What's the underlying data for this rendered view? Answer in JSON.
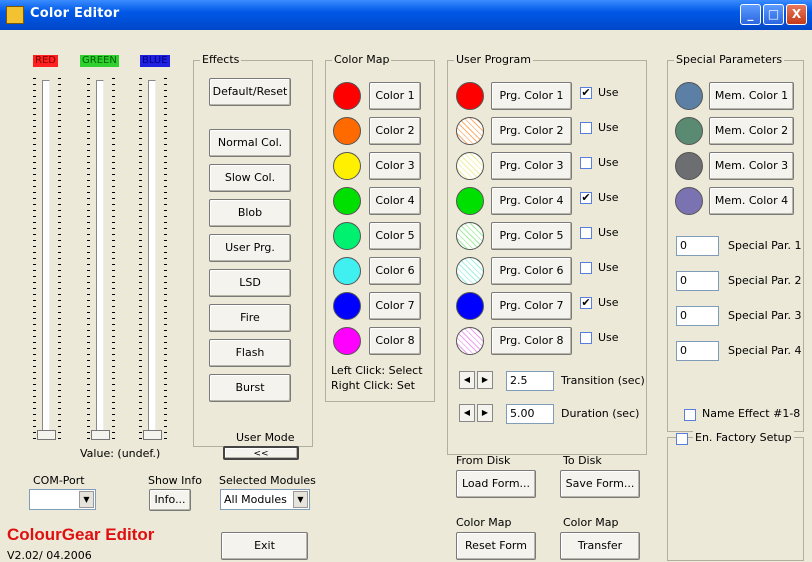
{
  "window": {
    "title": "Color Editor",
    "minimize": "_",
    "maximize": "□",
    "close": "X"
  },
  "sliders": {
    "red_label": "RED",
    "green_label": "GREEN",
    "blue_label": "BLUE",
    "colors": {
      "red": "#FF2020",
      "green": "#30D030",
      "blue": "#2020E0"
    },
    "value_label": "Value: (undef.)"
  },
  "effects": {
    "caption": "Effects",
    "buttons": [
      "Default/Reset",
      "Normal Col.",
      "Slow Col.",
      "Blob",
      "User Prg.",
      "LSD",
      "Fire",
      "Flash",
      "Burst"
    ]
  },
  "color_map": {
    "caption": "Color Map",
    "items": [
      {
        "label": "Color 1",
        "color": "#FF0000"
      },
      {
        "label": "Color 2",
        "color": "#FF6A00"
      },
      {
        "label": "Color 3",
        "color": "#FFF000"
      },
      {
        "label": "Color 4",
        "color": "#00E000"
      },
      {
        "label": "Color 5",
        "color": "#00F070"
      },
      {
        "label": "Color 6",
        "color": "#40F0F0"
      },
      {
        "label": "Color 7",
        "color": "#0000FF"
      },
      {
        "label": "Color 8",
        "color": "#FF00FF"
      }
    ],
    "hint_left": "Left Click: Select",
    "hint_right": "Right Click: Set"
  },
  "user_program": {
    "caption": "User Program",
    "use_label": "Use",
    "items": [
      {
        "label": "Prg. Color 1",
        "color": "#FF0000",
        "hatched": false,
        "use": true
      },
      {
        "label": "Prg. Color 2",
        "color": "#FFB070",
        "hatched": true,
        "use": false
      },
      {
        "label": "Prg. Color 3",
        "color": "#F0F0A0",
        "hatched": true,
        "use": false
      },
      {
        "label": "Prg. Color 4",
        "color": "#00E000",
        "hatched": false,
        "use": true
      },
      {
        "label": "Prg. Color 5",
        "color": "#A0F0A0",
        "hatched": true,
        "use": false
      },
      {
        "label": "Prg. Color 6",
        "color": "#A0F0E0",
        "hatched": true,
        "use": false
      },
      {
        "label": "Prg. Color 7",
        "color": "#0000FF",
        "hatched": false,
        "use": true
      },
      {
        "label": "Prg. Color 8",
        "color": "#F0A0F0",
        "hatched": true,
        "use": false
      }
    ],
    "transition_value": "2.5",
    "transition_label": "Transition (sec)",
    "duration_value": "5.00",
    "duration_label": "Duration (sec)"
  },
  "special": {
    "caption": "Special Parameters",
    "mem_colors": [
      {
        "label": "Mem. Color 1",
        "color": "#5C7FA6"
      },
      {
        "label": "Mem. Color 2",
        "color": "#5B8A72"
      },
      {
        "label": "Mem. Color 3",
        "color": "#6D6E72"
      },
      {
        "label": "Mem. Color 4",
        "color": "#7B72B2"
      }
    ],
    "params": [
      {
        "value": "0",
        "label": "Special Par. 1"
      },
      {
        "value": "0",
        "label": "Special Par. 2"
      },
      {
        "value": "0",
        "label": "Special Par. 3"
      },
      {
        "value": "0",
        "label": "Special Par. 4"
      }
    ],
    "name_effect_label": "Name Effect #1-8",
    "factory_label": "En. Factory Setup"
  },
  "bottom": {
    "com_port_label": "COM-Port",
    "show_info_label": "Show Info",
    "info_button": "Info...",
    "user_mode_label": "User Mode",
    "user_mode_button": "<<",
    "selected_modules_label": "Selected Modules",
    "selected_modules_value": "All Modules",
    "exit_button": "Exit",
    "from_disk_label": "From Disk",
    "to_disk_label": "To Disk",
    "load_button": "Load Form...",
    "save_button": "Save Form...",
    "color_map_label1": "Color Map",
    "color_map_label2": "Color Map",
    "reset_button": "Reset Form",
    "transfer_button": "Transfer",
    "brand": "ColourGear Editor",
    "version": "V2.02/ 04.2006"
  }
}
